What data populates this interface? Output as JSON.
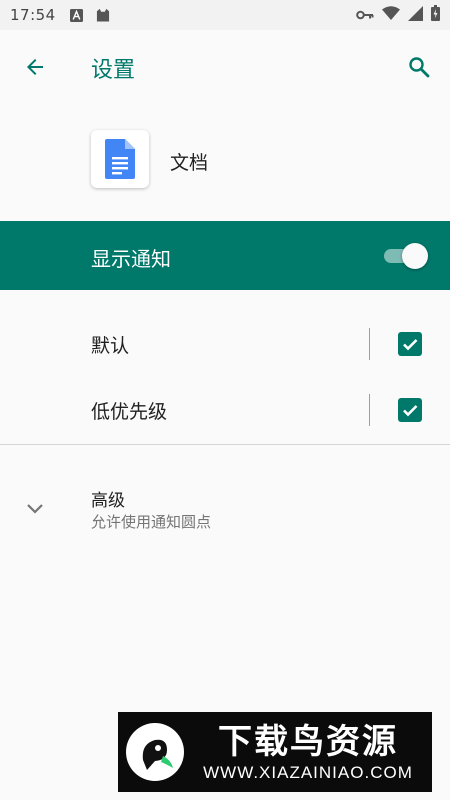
{
  "status_bar": {
    "time": "17:54",
    "icons": [
      "a-badge-icon",
      "cat-notification-icon",
      "vpn-key-icon",
      "wifi-icon",
      "signal-icon",
      "battery-icon"
    ]
  },
  "toolbar": {
    "title": "设置",
    "back_icon": "arrow-back-icon",
    "search_icon": "search-icon"
  },
  "app": {
    "name": "文档",
    "icon": "docs-file-icon"
  },
  "master_switch": {
    "label": "显示通知",
    "on": true
  },
  "channels": [
    {
      "label": "默认",
      "checked": true
    },
    {
      "label": "低优先级",
      "checked": true
    }
  ],
  "advanced": {
    "title": "高级",
    "summary": "允许使用通知圆点",
    "icon": "chevron-down-icon"
  },
  "watermark": {
    "title": "下载鸟资源",
    "url": "WWW.XIAZAINIAO.COM"
  },
  "colors": {
    "accent": "#00796b",
    "background": "#fafafa",
    "status_bar": "#f2f2f2"
  }
}
